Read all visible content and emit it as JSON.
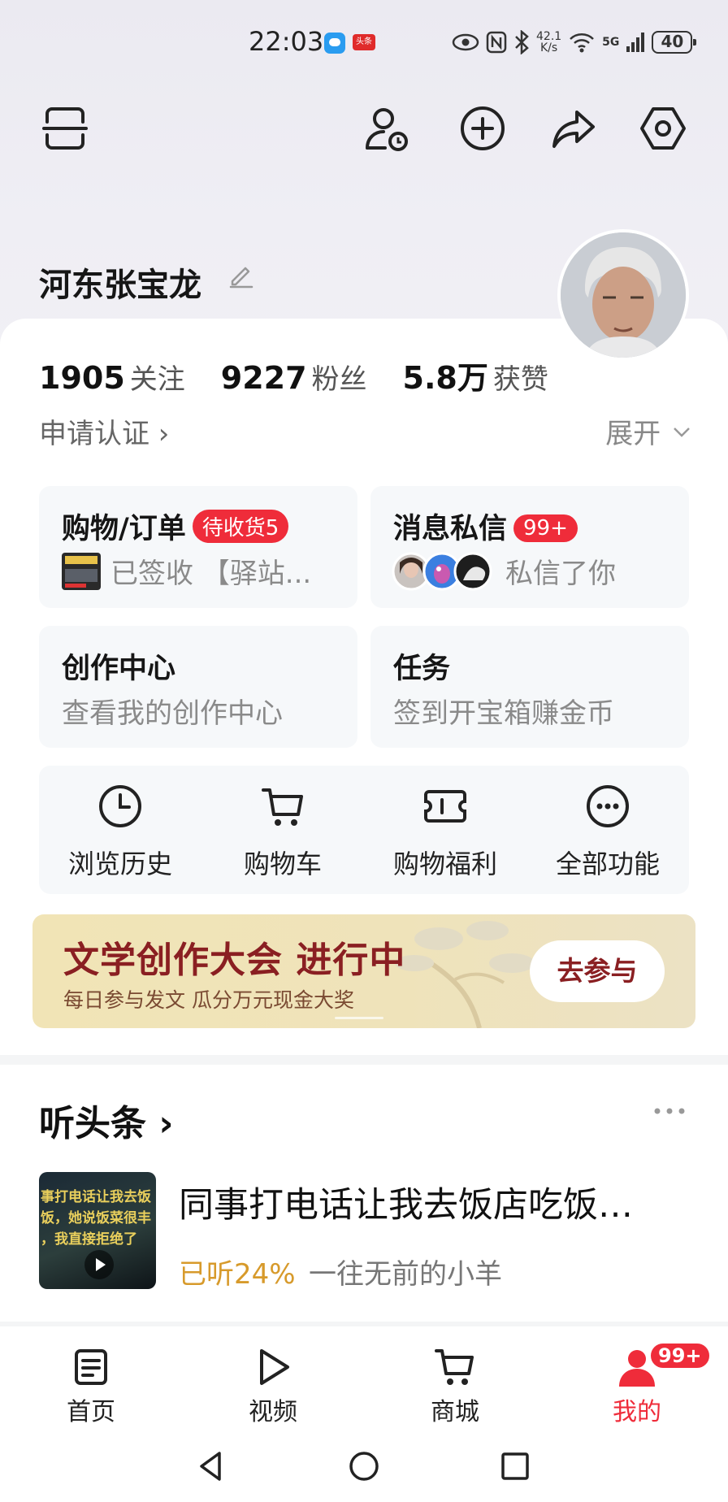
{
  "status_bar": {
    "time": "22:03",
    "app_badge": "头条",
    "net_speed_value": "42.1",
    "net_speed_unit": "K/s",
    "network": "5G",
    "battery": "40"
  },
  "header": {
    "icons": [
      "scan-icon",
      "add-friend-icon",
      "plus-circle-icon",
      "share-icon",
      "settings-icon"
    ]
  },
  "profile": {
    "username": "河东张宝龙",
    "stats": [
      {
        "value": "1905",
        "label": "关注"
      },
      {
        "value": "9227",
        "label": "粉丝"
      },
      {
        "value": "5.8万",
        "label": "获赞"
      }
    ],
    "verify_label": "申请认证 ›",
    "expand_label": "展开"
  },
  "tiles": {
    "orders": {
      "title": "购物/订单",
      "badge": "待收货5",
      "subtitle": "已签收 【驿站..."
    },
    "messages": {
      "title": "消息私信",
      "badge": "99+",
      "subtitle": "私信了你"
    },
    "creator": {
      "title": "创作中心",
      "subtitle": "查看我的创作中心"
    },
    "tasks": {
      "title": "任务",
      "subtitle": "签到开宝箱赚金币"
    }
  },
  "quick_actions": [
    {
      "label": "浏览历史",
      "icon": "clock-icon"
    },
    {
      "label": "购物车",
      "icon": "cart-icon"
    },
    {
      "label": "购物福利",
      "icon": "ticket-icon"
    },
    {
      "label": "全部功能",
      "icon": "more-icon"
    }
  ],
  "banner": {
    "title": "文学创作大会 进行中",
    "subtitle": "每日参与发文 瓜分万元现金大奖",
    "button": "去参与"
  },
  "listen": {
    "section_title": "听头条 ›",
    "thumb_text": [
      "事打电话让我去饭",
      "饭，她说饭菜很丰",
      "，我直接拒绝了"
    ],
    "headline": "同事打电话让我去饭店吃饭…",
    "progress": "已听24%",
    "author": "一往无前的小羊"
  },
  "bottom_nav": [
    {
      "label": "首页",
      "icon": "home-doc-icon",
      "active": false
    },
    {
      "label": "视频",
      "icon": "play-icon",
      "active": false
    },
    {
      "label": "商城",
      "icon": "cart-icon",
      "active": false
    },
    {
      "label": "我的",
      "icon": "profile-icon",
      "active": true,
      "badge": "99+"
    }
  ],
  "colors": {
    "accent_red": "#ef2c3a",
    "progress_gold": "#d79a2b",
    "banner_title": "#8a1f22"
  }
}
